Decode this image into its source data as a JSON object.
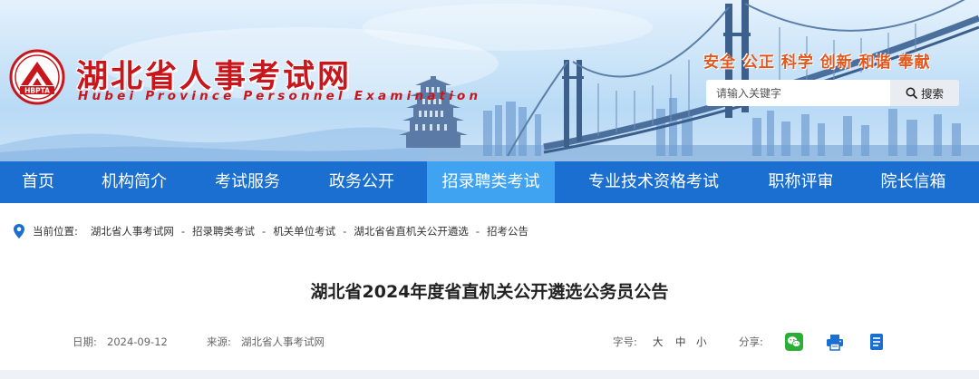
{
  "header": {
    "logo_abbr": "HBPTA",
    "site_title_cn": "湖北省人事考试网",
    "site_title_en": "Hubei Province Personnel Examination",
    "slogan": "安全 公正 科学 创新 和谐 奉献"
  },
  "search": {
    "placeholder": "请输入关键字",
    "value": "",
    "button_label": "搜索",
    "icon": "search-icon"
  },
  "nav": {
    "items": [
      {
        "label": "首页",
        "active": false
      },
      {
        "label": "机构简介",
        "active": false
      },
      {
        "label": "考试服务",
        "active": false
      },
      {
        "label": "政务公开",
        "active": false
      },
      {
        "label": "招录聘类考试",
        "active": true
      },
      {
        "label": "专业技术资格考试",
        "active": false
      },
      {
        "label": "职称评审",
        "active": false
      },
      {
        "label": "院长信箱",
        "active": false
      }
    ]
  },
  "breadcrumb": {
    "label": "当前位置:",
    "items": [
      "湖北省人事考试网",
      "招录聘类考试",
      "机关单位考试",
      "湖北省省直机关公开遴选",
      "招考公告"
    ],
    "separator": "-",
    "icon": "location-pin-icon"
  },
  "article": {
    "title": "湖北省2024年度省直机关公开遴选公务员公告",
    "date_label": "日期:",
    "date": "2024-09-12",
    "source_label": "来源:",
    "source": "湖北省人事考试网",
    "font_size_label": "字号:",
    "font_size_options": [
      "大",
      "中",
      "小"
    ],
    "share_label": "分享:",
    "share_icons": [
      "wechat-icon",
      "print-icon",
      "document-icon"
    ]
  },
  "colors": {
    "nav_bg": "#1a6fd0",
    "nav_active_bg": "#3fa3f2",
    "title_red": "#c8161d",
    "slogan_orange": "#e3571c",
    "wechat_green": "#2aae35",
    "icon_blue": "#1a6fd0"
  }
}
